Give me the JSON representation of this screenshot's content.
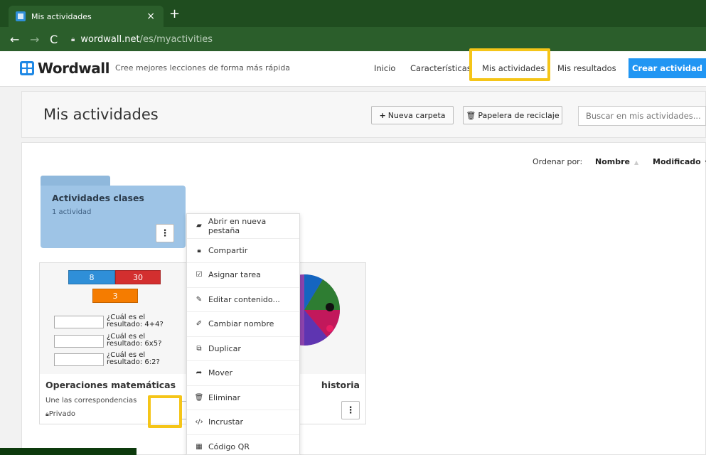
{
  "browser": {
    "tab_title": "Mis actividades",
    "tab_close": "×",
    "new_tab": "+",
    "url_domain": "wordwall.net",
    "url_path": "/es/myactivities"
  },
  "header": {
    "logo_text": "Wordwall",
    "tagline": "Cree mejores lecciones de forma más rápida",
    "nav": [
      "Inicio",
      "Características",
      "Mis actividades",
      "Mis resultados"
    ],
    "cta": "Crear actividad"
  },
  "page": {
    "title": "Mis actividades",
    "new_folder": "Nueva carpeta",
    "recycle_bin": "Papelera de reciclaje",
    "search_placeholder": "Buscar en mis actividades..."
  },
  "sort": {
    "label": "Ordenar por:",
    "name": "Nombre",
    "modified": "Modificado"
  },
  "folder": {
    "title": "Actividades clases",
    "count": "1 actividad"
  },
  "card1": {
    "tiles": [
      "8",
      "30",
      "3"
    ],
    "questions": [
      "¿Cuál es el resultado: 4+4?",
      "¿Cuál es el resultado: 6x5?",
      "¿Cuál es el resultado: 6:2?"
    ],
    "title": "Operaciones matemáticas",
    "subtitle": "Une las correspondencias",
    "privacy": "Privado"
  },
  "card2": {
    "title_fragment": "historia"
  },
  "menu": {
    "items": [
      "Abrir en nueva pestaña",
      "Compartir",
      "Asignar tarea",
      "Editar contenido...",
      "Cambiar nombre",
      "Duplicar",
      "Mover",
      "Eliminar",
      "Incrustar",
      "Código QR"
    ]
  },
  "colors": {
    "accent": "#2196f3",
    "highlight": "#f5c518",
    "folder": "#9ec4e6",
    "tile_blue": "#2f8fd8",
    "tile_red": "#d32f2f",
    "tile_orange": "#f57c00"
  }
}
